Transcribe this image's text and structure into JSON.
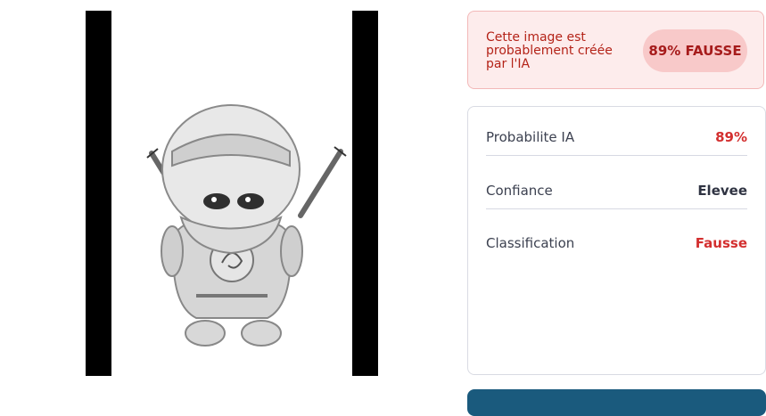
{
  "alert": {
    "message": "Cette image est probablement créée par l'IA",
    "badge": "89% FAUSSE"
  },
  "metrics": [
    {
      "label": "Probabilite IA",
      "value": "89%"
    },
    {
      "label": "Confiance",
      "value": "Elevee"
    },
    {
      "label": "Classification",
      "value": "Fausse"
    }
  ],
  "colors": {
    "alert_bg": "#fdecec",
    "alert_text": "#b42318",
    "red_value": "#d32f2f",
    "primary_button": "#1a5a7d"
  }
}
